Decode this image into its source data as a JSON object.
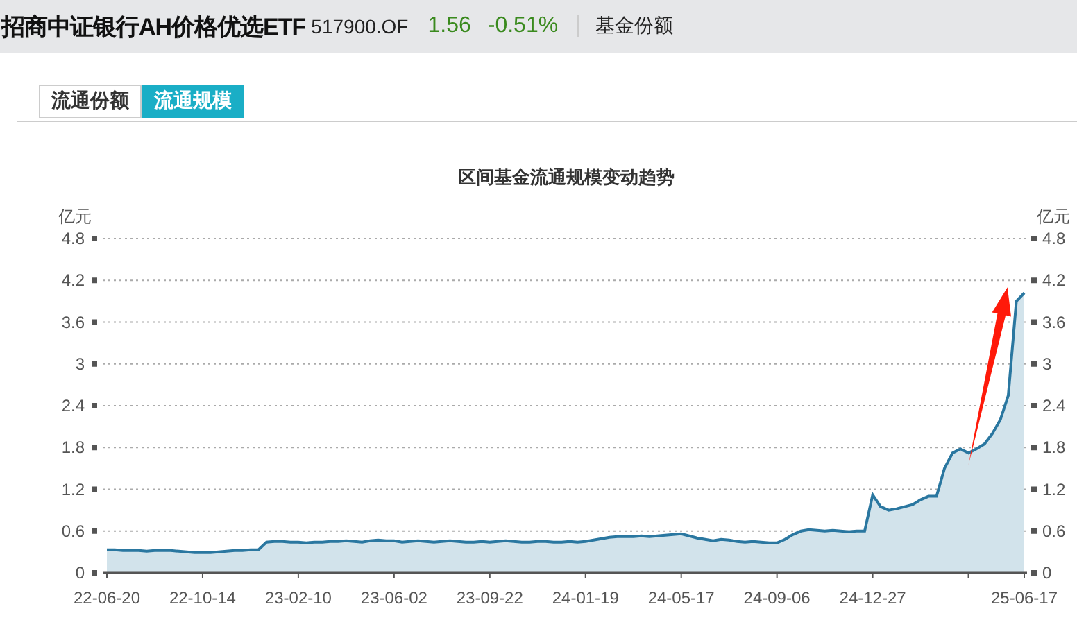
{
  "header": {
    "fund_name": "招商中证银行AH价格优选ETF",
    "code": "517900.OF",
    "price": "1.56",
    "change": "-0.51%",
    "section": "基金份额"
  },
  "tabs": [
    {
      "label": "流通份额",
      "selected": false
    },
    {
      "label": "流通规模",
      "selected": true
    }
  ],
  "chart": {
    "chart_data": {
      "type": "area",
      "title": "区间基金流通规模变动趋势",
      "ylabel": "亿元",
      "ylim": [
        0,
        4.8
      ],
      "yticks": [
        0,
        0.6,
        1.2,
        1.8,
        2.4,
        3,
        3.6,
        4.2,
        4.8
      ],
      "y2label": "亿元",
      "y2lim": [
        0,
        4.8
      ],
      "y2ticks": [
        0,
        0.6,
        1.2,
        1.8,
        2.4,
        3,
        3.6,
        4.2,
        4.8
      ],
      "grid": true,
      "categories": [
        "22-06-20",
        null,
        null,
        null,
        null,
        null,
        null,
        null,
        null,
        null,
        null,
        null,
        "22-10-14",
        null,
        null,
        null,
        null,
        null,
        null,
        null,
        null,
        null,
        null,
        null,
        "23-02-10",
        null,
        null,
        null,
        null,
        null,
        null,
        null,
        null,
        null,
        null,
        null,
        "23-06-02",
        null,
        null,
        null,
        null,
        null,
        null,
        null,
        null,
        null,
        null,
        null,
        "23-09-22",
        null,
        null,
        null,
        null,
        null,
        null,
        null,
        null,
        null,
        null,
        null,
        "24-01-19",
        null,
        null,
        null,
        null,
        null,
        null,
        null,
        null,
        null,
        null,
        null,
        "24-05-17",
        null,
        null,
        null,
        null,
        null,
        null,
        null,
        null,
        null,
        null,
        null,
        "24-09-06",
        null,
        null,
        null,
        null,
        null,
        null,
        null,
        null,
        null,
        null,
        null,
        "24-12-27",
        null,
        null,
        null,
        null,
        null,
        null,
        null,
        null,
        null,
        null,
        null,
        null,
        null,
        null,
        null,
        null,
        null,
        null,
        "25-06-17"
      ],
      "series": [
        {
          "color": "#2a77a0",
          "values": [
            0.33,
            0.33,
            0.32,
            0.32,
            0.32,
            0.31,
            0.32,
            0.32,
            0.32,
            0.31,
            0.3,
            0.29,
            0.29,
            0.29,
            0.3,
            0.31,
            0.32,
            0.32,
            0.33,
            0.33,
            0.44,
            0.45,
            0.45,
            0.44,
            0.44,
            0.43,
            0.44,
            0.44,
            0.45,
            0.45,
            0.46,
            0.45,
            0.44,
            0.46,
            0.47,
            0.46,
            0.46,
            0.44,
            0.45,
            0.46,
            0.45,
            0.44,
            0.45,
            0.46,
            0.45,
            0.44,
            0.44,
            0.45,
            0.44,
            0.45,
            0.46,
            0.45,
            0.44,
            0.44,
            0.45,
            0.45,
            0.44,
            0.44,
            0.45,
            0.44,
            0.45,
            0.47,
            0.49,
            0.51,
            0.52,
            0.52,
            0.52,
            0.53,
            0.52,
            0.53,
            0.54,
            0.55,
            0.56,
            0.53,
            0.5,
            0.48,
            0.46,
            0.48,
            0.47,
            0.45,
            0.44,
            0.45,
            0.44,
            0.43,
            0.43,
            0.48,
            0.55,
            0.6,
            0.62,
            0.61,
            0.6,
            0.61,
            0.6,
            0.59,
            0.6,
            0.6,
            1.12,
            0.95,
            0.9,
            0.92,
            0.95,
            0.98,
            1.05,
            1.1,
            1.1,
            1.5,
            1.72,
            1.78,
            1.72,
            1.78,
            1.85,
            2.0,
            2.2,
            2.55,
            3.9,
            4.02
          ]
        }
      ]
    }
  },
  "overlay_arrow": {
    "color": "#ff1a0a"
  }
}
